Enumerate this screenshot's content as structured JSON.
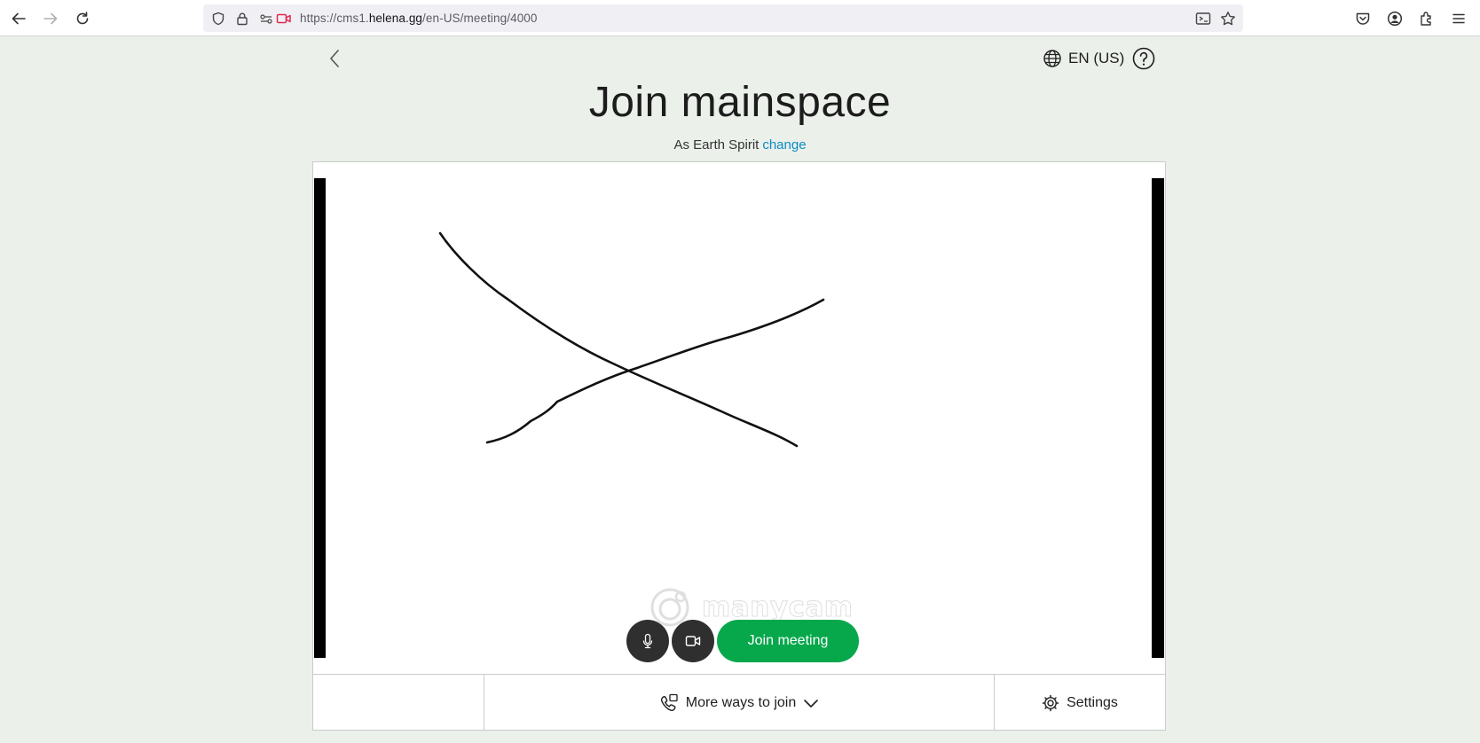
{
  "browser": {
    "url_prefix": "https://cms1.",
    "url_domain": "helena.gg",
    "url_path": "/en-US/meeting/4000"
  },
  "header": {
    "language": "EN (US)"
  },
  "page": {
    "title": "Join mainspace",
    "as_prefix": "As Earth Spirit",
    "change_link": "change"
  },
  "preview": {
    "watermark": "manycam"
  },
  "controls": {
    "join_label": "Join meeting"
  },
  "footer": {
    "more_ways_label": "More ways to join",
    "settings_label": "Settings"
  },
  "colors": {
    "page_background": "#ebf0ea",
    "join_button": "#07a84c",
    "link": "#0b8cc4",
    "control_button": "#2f2f2f"
  },
  "icons": [
    "back-arrow-icon",
    "forward-arrow-icon",
    "reload-icon",
    "shield-icon",
    "lock-icon",
    "permissions-icon",
    "camera-sharing-icon",
    "reader-view-icon",
    "bookmark-star-icon",
    "pocket-icon",
    "account-icon",
    "extensions-icon",
    "menu-icon",
    "chevron-left-icon",
    "globe-icon",
    "help-icon",
    "microphone-icon",
    "camera-icon",
    "phone-icon",
    "chevron-down-icon",
    "gear-icon"
  ]
}
